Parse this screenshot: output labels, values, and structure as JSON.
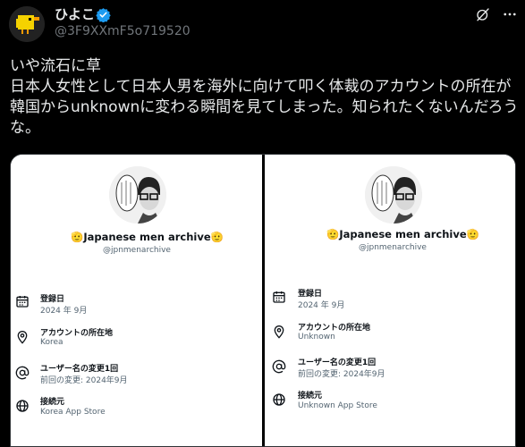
{
  "post": {
    "author_name": "ひよこ",
    "author_handle": "@3F9XXmF5o719520",
    "text_lines": [
      "いや流石に草",
      "日本人女性として日本人男を海外に向けて叩く体裁のアカウントの所在が",
      "韓国からunknownに変わる瞬間を見てしまった。知られたくないんだろう",
      "な。"
    ]
  },
  "icons": {
    "avatar": "chick-avatar",
    "verified": "verified-badge-icon",
    "grok": "grok-icon",
    "more": "more-icon"
  },
  "colors": {
    "background": "#000000",
    "verified": "#1d9bf0",
    "secondary_text": "#71767b"
  },
  "screenshot_left": {
    "name": "🫡Japanese men archive🫡",
    "handle": "@jpnmenarchive",
    "rows": [
      {
        "icon": "calendar-icon",
        "label": "登録日",
        "value": "2024 年 9月"
      },
      {
        "icon": "location-icon",
        "label": "アカウントの所在地",
        "value": "Korea"
      },
      {
        "icon": "at-icon",
        "label": "ユーザー名の変更1回",
        "value": "前回の変更: 2024年9月"
      },
      {
        "icon": "globe-icon",
        "label": "接続元",
        "value": "Korea App Store"
      }
    ]
  },
  "screenshot_right": {
    "name": "🫡Japanese men archive🫡",
    "handle": "@jpnmenarchive",
    "rows": [
      {
        "icon": "calendar-icon",
        "label": "登録日",
        "value": "2024 年 9月"
      },
      {
        "icon": "location-icon",
        "label": "アカウントの所在地",
        "value": "Unknown"
      },
      {
        "icon": "at-icon",
        "label": "ユーザー名の変更1回",
        "value": "前回の変更: 2024年9月"
      },
      {
        "icon": "globe-icon",
        "label": "接続元",
        "value": "Unknown App Store"
      }
    ]
  }
}
